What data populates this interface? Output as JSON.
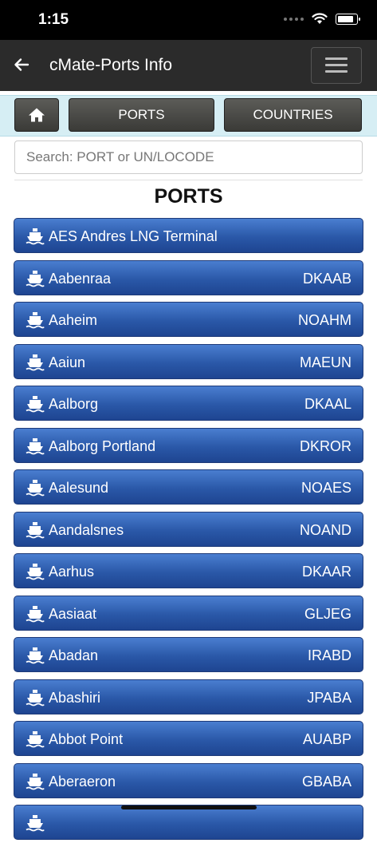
{
  "status_bar": {
    "time": "1:15"
  },
  "header": {
    "title": "cMate-Ports Info"
  },
  "nav": {
    "ports_label": "PORTS",
    "countries_label": "COUNTRIES"
  },
  "search": {
    "placeholder": "Search: PORT or UN/LOCODE",
    "value": ""
  },
  "section_title": "PORTS",
  "ports": [
    {
      "name": "AES Andres LNG Terminal",
      "code": ""
    },
    {
      "name": "Aabenraa",
      "code": "DKAAB"
    },
    {
      "name": "Aaheim",
      "code": "NOAHM"
    },
    {
      "name": "Aaiun",
      "code": "MAEUN"
    },
    {
      "name": "Aalborg",
      "code": "DKAAL"
    },
    {
      "name": "Aalborg Portland",
      "code": "DKROR"
    },
    {
      "name": "Aalesund",
      "code": "NOAES"
    },
    {
      "name": "Aandalsnes",
      "code": "NOAND"
    },
    {
      "name": "Aarhus",
      "code": "DKAAR"
    },
    {
      "name": "Aasiaat",
      "code": "GLJEG"
    },
    {
      "name": "Abadan",
      "code": "IRABD"
    },
    {
      "name": "Abashiri",
      "code": "JPABA"
    },
    {
      "name": "Abbot Point",
      "code": "AUABP"
    },
    {
      "name": "Aberaeron",
      "code": "GBABA"
    },
    {
      "name": "",
      "code": ""
    }
  ],
  "icons": {
    "back": "arrow-left-icon",
    "menu": "hamburger-icon",
    "home": "home-icon",
    "port": "ship-icon"
  },
  "colors": {
    "header_bg": "#2b2b2b",
    "nav_bg": "#d6eef4",
    "port_button": "#2a58a8"
  }
}
